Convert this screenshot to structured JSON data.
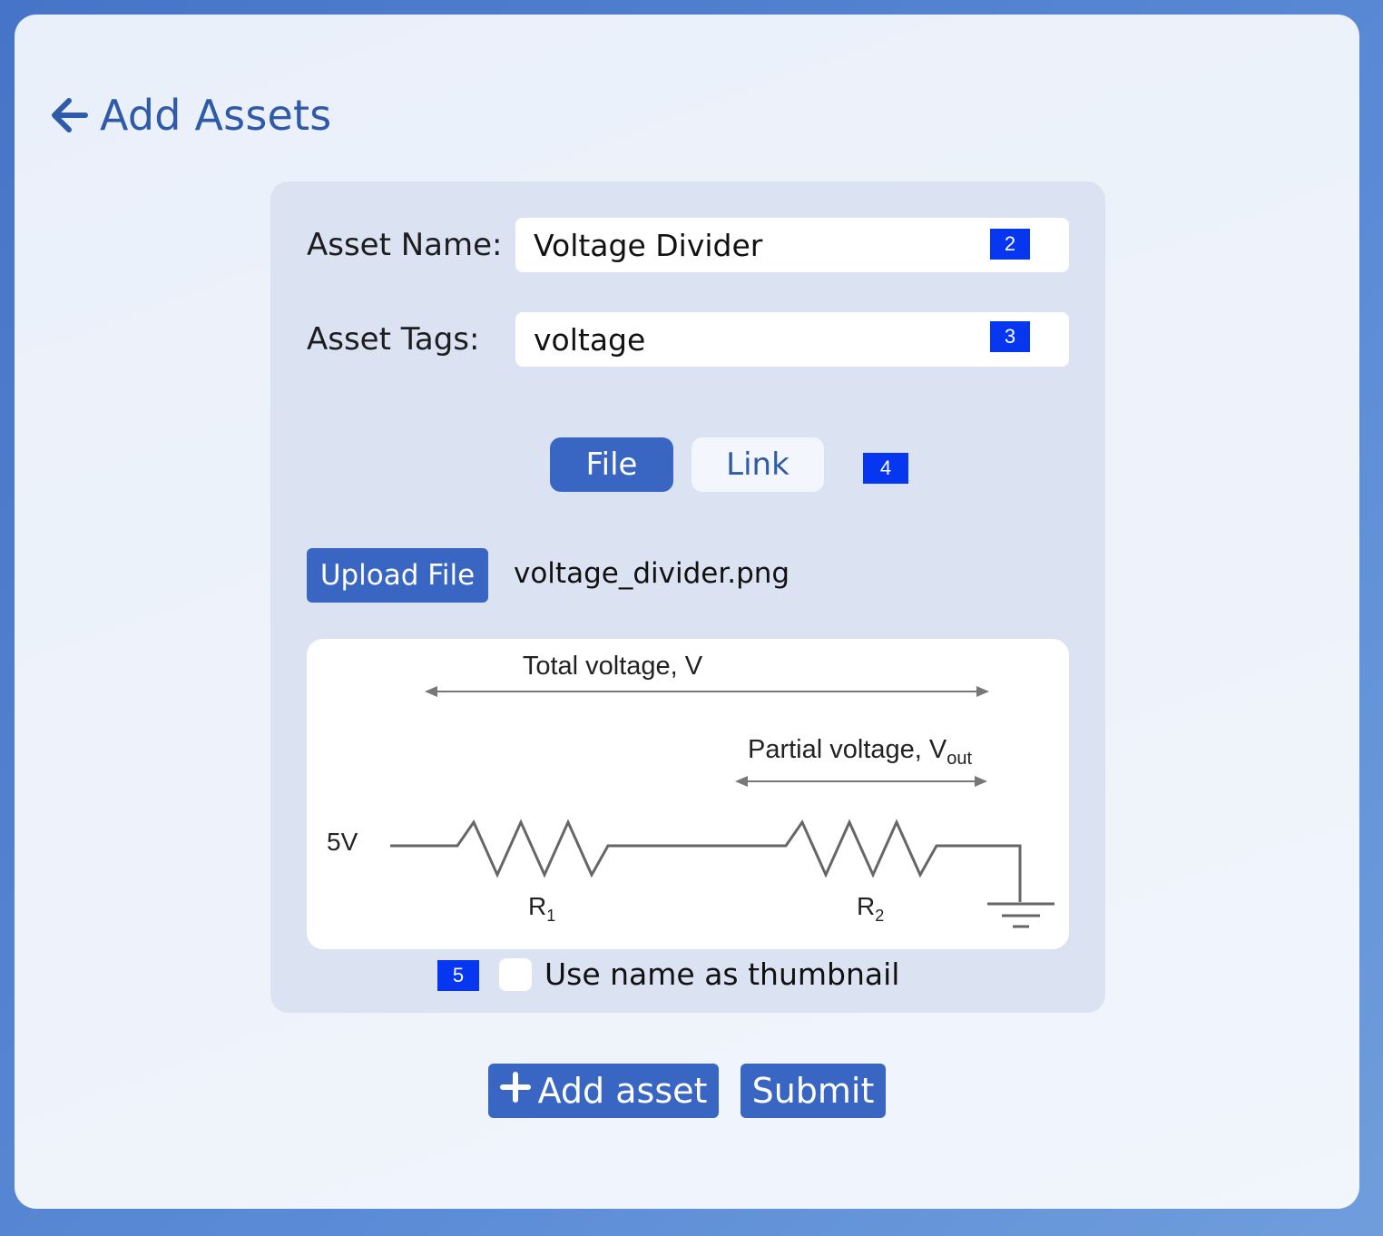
{
  "header": {
    "title": "Add Assets",
    "back_icon": "arrow-left-icon"
  },
  "form": {
    "asset_name": {
      "label": "Asset Name:",
      "value": "Voltage Divider",
      "badge": "2"
    },
    "asset_tags": {
      "label": "Asset Tags:",
      "value": "voltage",
      "badge": "3"
    },
    "source_toggle": {
      "options": [
        "File",
        "Link"
      ],
      "selected": "File",
      "badge": "4"
    },
    "upload": {
      "button_label": "Upload File",
      "filename": "voltage_divider.png"
    },
    "preview": {
      "total_voltage_label": "Total voltage, V",
      "partial_voltage_label": "Partial voltage, V",
      "partial_voltage_sub": "out",
      "source_label": "5V",
      "r1_label": "R",
      "r1_sub": "1",
      "r2_label": "R",
      "r2_sub": "2"
    },
    "thumbnail_checkbox": {
      "label": "Use name as thumbnail",
      "checked": false,
      "badge": "5"
    }
  },
  "actions": {
    "add_asset_label": "Add asset",
    "submit_label": "Submit"
  },
  "colors": {
    "accent": "#3966c2",
    "title": "#2f5aa8",
    "badge": "#0636f0",
    "panel": "#dbe2f1"
  }
}
